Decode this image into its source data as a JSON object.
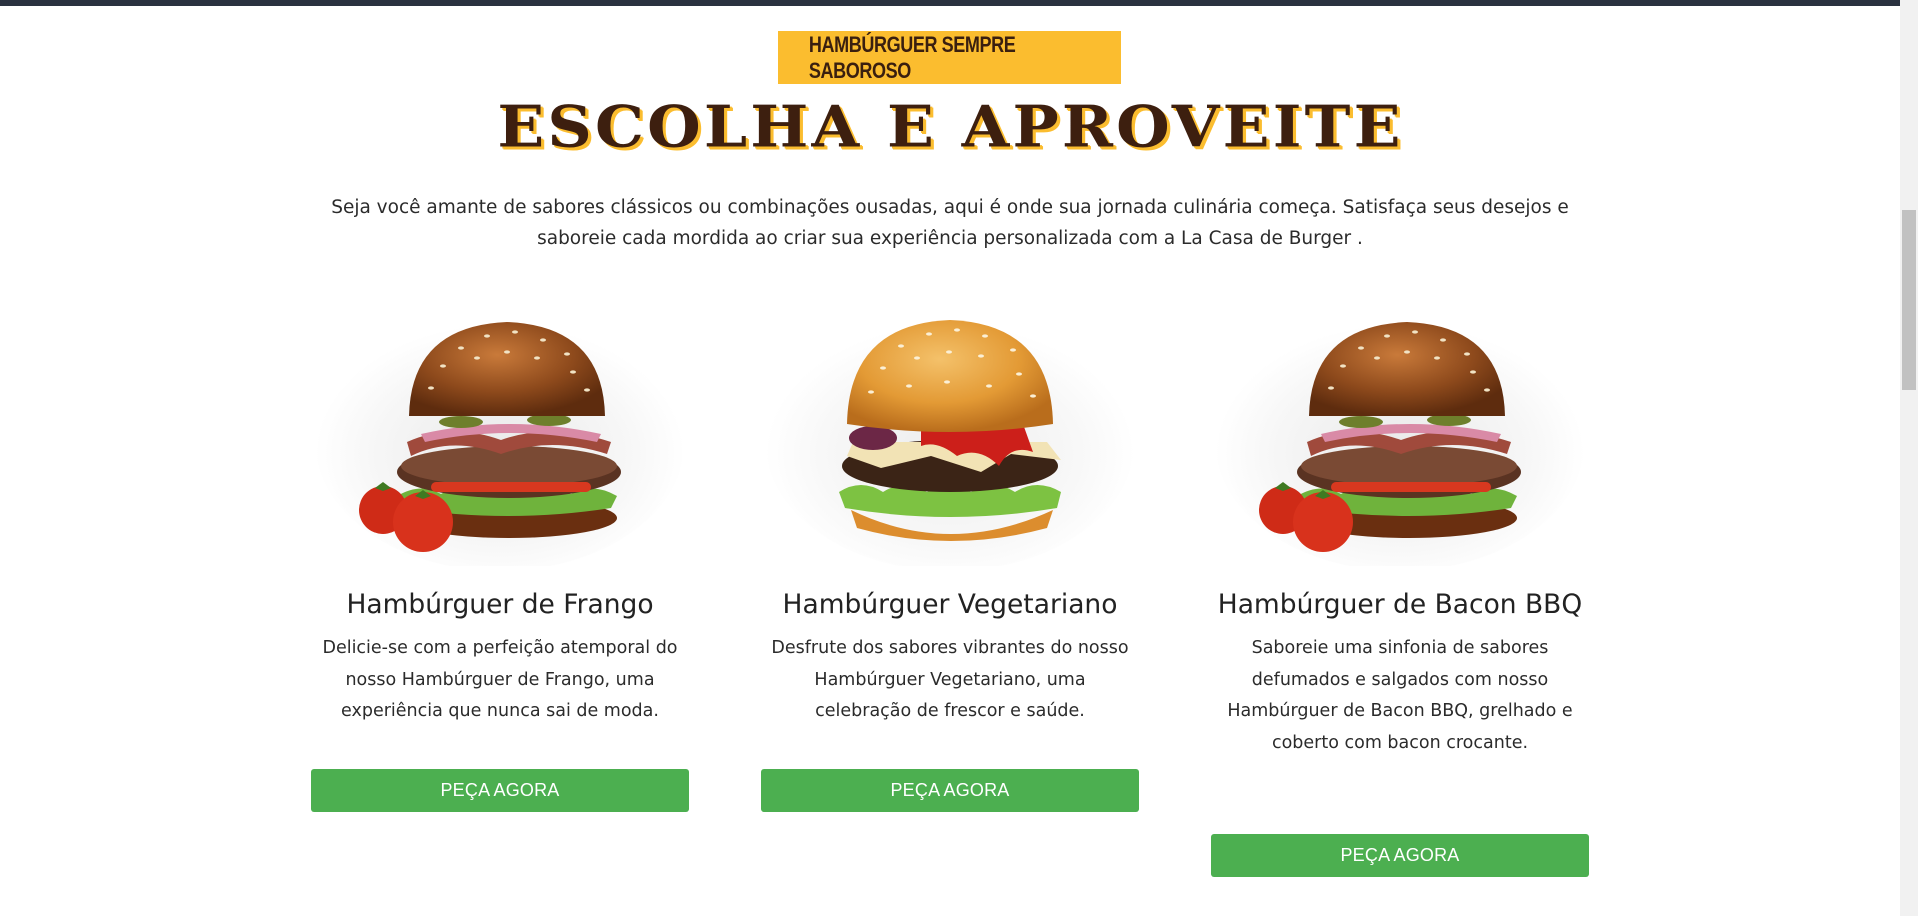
{
  "section": {
    "tagline": "HAMBÚRGUER SEMPRE SABOROSO",
    "title": "ESCOLHA E APROVEITE",
    "intro": "Seja você amante de sabores clássicos ou combinações ousadas, aqui é onde sua jornada culinária começa. Satisfaça seus desejos e saboreie cada mordida ao criar sua experiência personalizada com a La Casa de Burger ."
  },
  "cards": [
    {
      "title": "Hambúrguer de Frango",
      "description": "Delicie-se com a perfeição atemporal do nosso Hambúrguer de Frango, uma experiência que nunca sai de moda.",
      "button": "PEÇA AGORA",
      "image": "bacon-burger-with-tomatoes-image"
    },
    {
      "title": "Hambúrguer Vegetariano",
      "description": "Desfrute dos sabores vibrantes do nosso Hambúrguer Vegetariano, uma celebração de frescor e saúde.",
      "button": "PEÇA AGORA",
      "image": "cheese-ketchup-burger-image"
    },
    {
      "title": "Hambúrguer de Bacon BBQ",
      "description": "Saboreie uma sinfonia de sabores defumados e salgados com nosso Hambúrguer de Bacon BBQ, grelhado e coberto com bacon crocante.",
      "button": "PEÇA AGORA",
      "image": "bacon-burger-with-tomatoes-image"
    }
  ],
  "colors": {
    "tagline_bg": "#fbbd2f",
    "title_text": "#3d1f0f",
    "button_bg": "#4caf50",
    "top_bar": "#2a3240"
  }
}
